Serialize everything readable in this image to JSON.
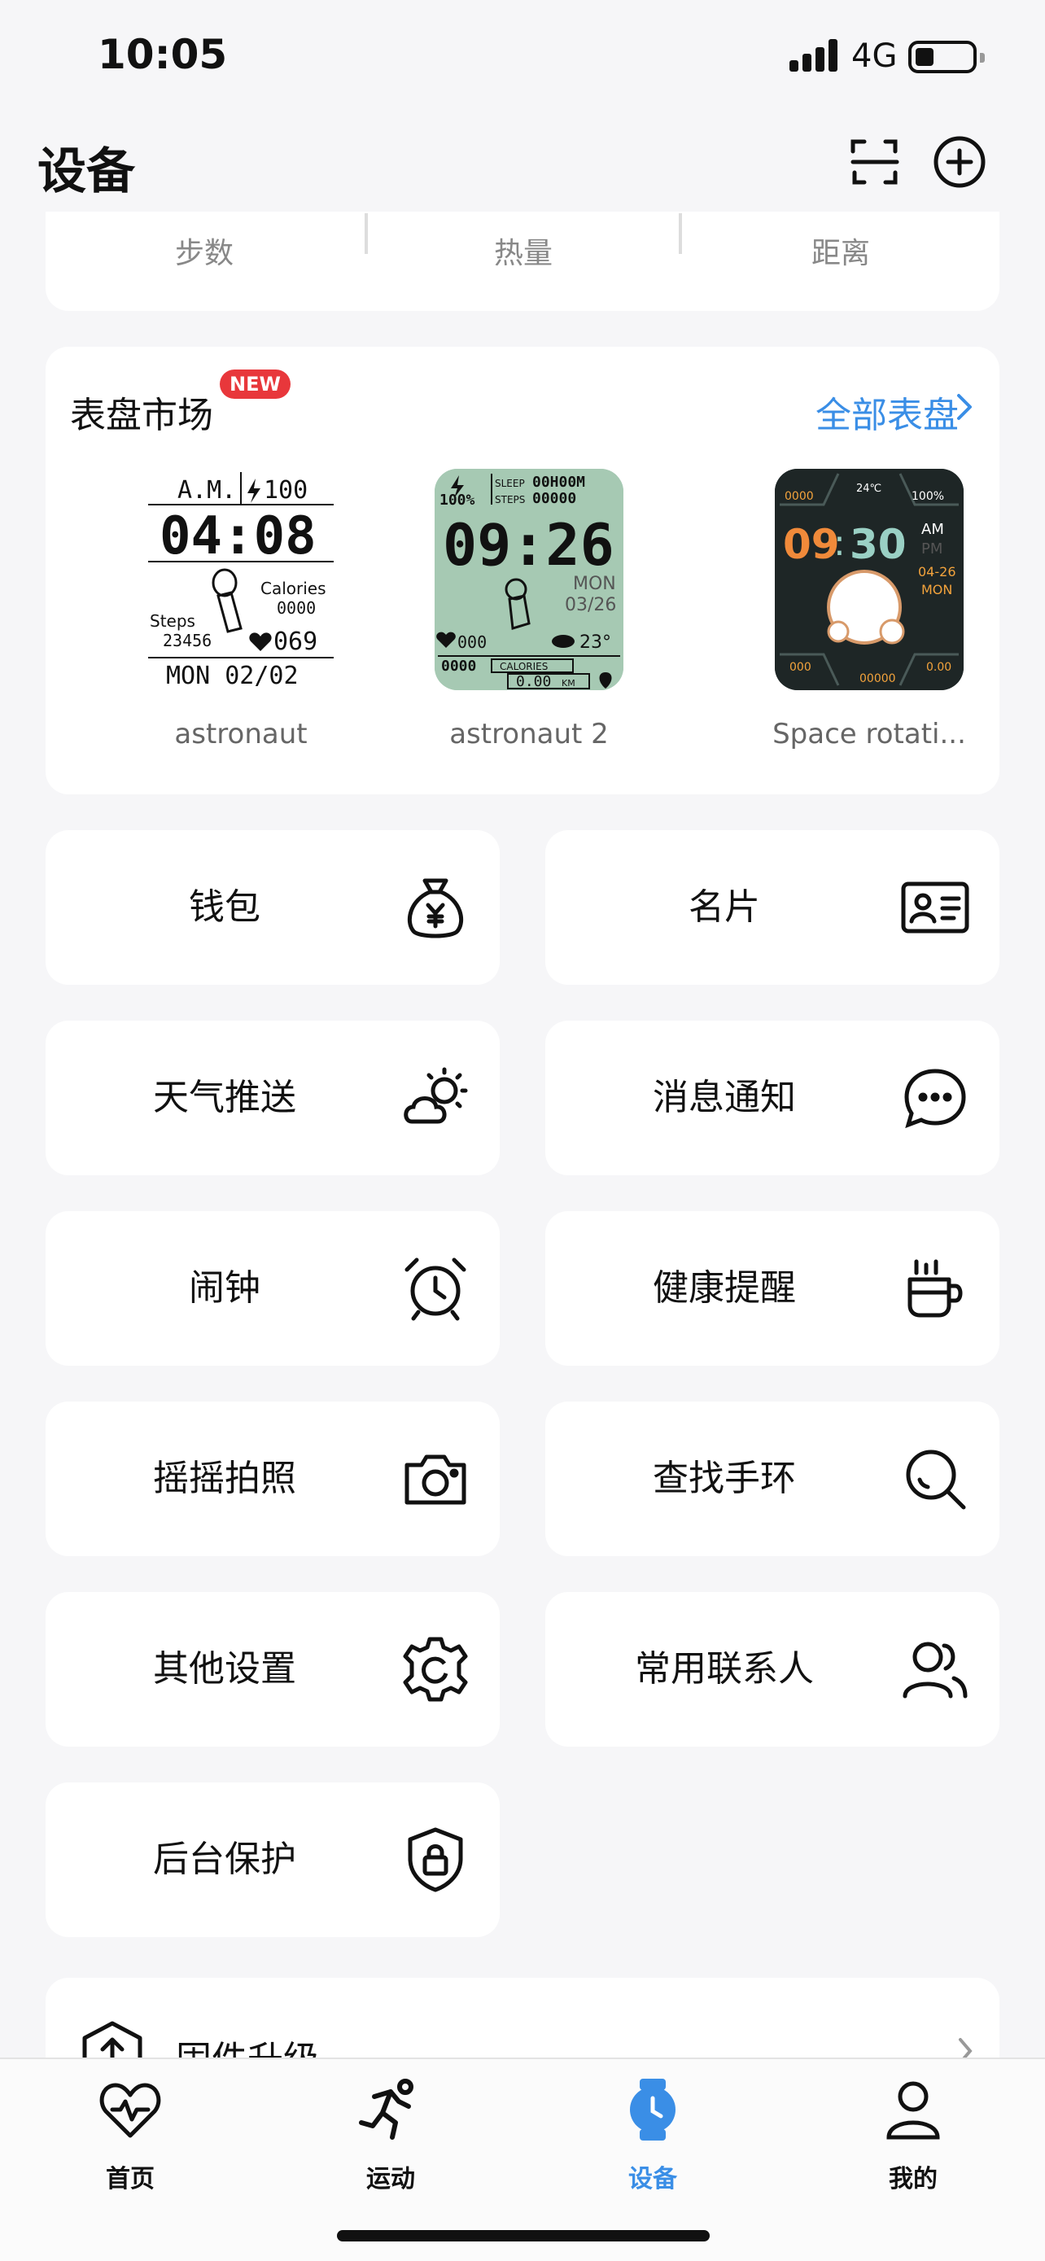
{
  "status_bar": {
    "time": "10:05",
    "network": "4G"
  },
  "header": {
    "title": "设备",
    "scan_icon": "scan-icon",
    "add_icon": "plus-circle-icon"
  },
  "stats": {
    "items": [
      "步数",
      "热量",
      "距离"
    ]
  },
  "market": {
    "title": "表盘市场",
    "badge": "NEW",
    "all_link": "全部表盘",
    "faces": [
      {
        "name": "astronaut",
        "time": "04:08",
        "date": "MON 02/02",
        "top_left": "A.M.",
        "top_right": "100",
        "calories_label": "Calories",
        "calories": "0000",
        "steps_label": "Steps",
        "steps": "23456",
        "heart": "069"
      },
      {
        "name": "astronaut 2",
        "time": "09:26",
        "battery": "100%",
        "sleep_label": "SLEEP",
        "sleep": "00H00M",
        "steps_label": "STEPS",
        "steps": "00000",
        "weekday": "MON",
        "date": "03/26",
        "heart": "000",
        "temp": "23°",
        "calories_label": "CALORIES",
        "calories": "0000",
        "distance": "0.00",
        "distance_unit": "KM"
      },
      {
        "name": "Space rotati...",
        "hour": "09",
        "minute": "30",
        "am": "AM",
        "pm": "PM",
        "date": "04-26",
        "weekday": "MON",
        "top_left": "0000",
        "top_mid": "24℃",
        "top_right": "100%",
        "bottom_left": "000",
        "bottom_mid": "00000",
        "bottom_right": "0.00"
      }
    ]
  },
  "functions": [
    {
      "label": "钱包",
      "icon": "money-bag-icon"
    },
    {
      "label": "名片",
      "icon": "id-card-icon"
    },
    {
      "label": "天气推送",
      "icon": "weather-icon"
    },
    {
      "label": "消息通知",
      "icon": "chat-bubble-icon"
    },
    {
      "label": "闹钟",
      "icon": "alarm-clock-icon"
    },
    {
      "label": "健康提醒",
      "icon": "coffee-cup-icon"
    },
    {
      "label": "摇摇拍照",
      "icon": "camera-icon"
    },
    {
      "label": "查找手环",
      "icon": "search-icon"
    },
    {
      "label": "其他设置",
      "icon": "gear-icon"
    },
    {
      "label": "常用联系人",
      "icon": "contacts-icon"
    },
    {
      "label": "后台保护",
      "icon": "shield-lock-icon"
    }
  ],
  "firmware": {
    "label": "固件升级",
    "icon": "upgrade-icon"
  },
  "tabs": [
    {
      "label": "首页",
      "icon": "heart-pulse-icon"
    },
    {
      "label": "运动",
      "icon": "running-icon"
    },
    {
      "label": "设备",
      "icon": "watch-icon",
      "active": true
    },
    {
      "label": "我的",
      "icon": "profile-icon"
    }
  ],
  "colors": {
    "accent": "#3a8ee6",
    "badge": "#e8373b",
    "background": "#f6f6f8",
    "card": "#ffffff"
  }
}
